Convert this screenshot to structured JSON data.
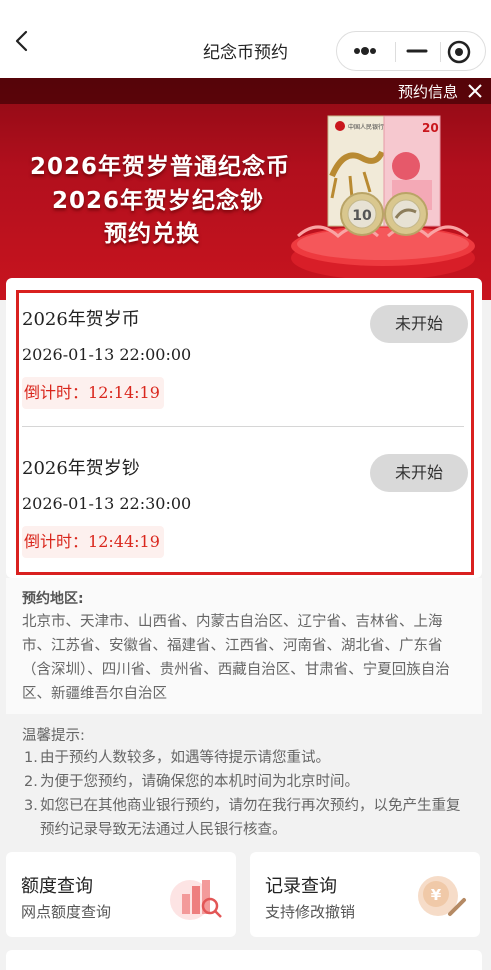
{
  "nav": {
    "title": "纪念币预约"
  },
  "banner": {
    "notice": "预约信息",
    "lines": [
      "2026年贺岁普通纪念币",
      "2026年贺岁纪念钞",
      "预约兑换"
    ],
    "art": {
      "note_value": "20",
      "note_label": "中国人民银行",
      "coin_value": "10"
    }
  },
  "reservations": [
    {
      "name": "2026年贺岁币",
      "time": "2026-01-13 22:00:00",
      "countdown_label": "倒计时：",
      "countdown": "12:14:19",
      "status": "未开始"
    },
    {
      "name": "2026年贺岁钞",
      "time": "2026-01-13 22:30:00",
      "countdown_label": "倒计时：",
      "countdown": "12:44:19",
      "status": "未开始"
    }
  ],
  "region": {
    "title": "预约地区:",
    "text": "北京市、天津市、山西省、内蒙古自治区、辽宁省、吉林省、上海市、江苏省、安徽省、福建省、江西省、河南省、湖北省、广东省（含深圳）、四川省、贵州省、西藏自治区、甘肃省、宁夏回族自治区、新疆维吾尔自治区"
  },
  "tips": {
    "title": "温馨提示:",
    "items": [
      {
        "num": "1.",
        "text": "由于预约人数较多，如遇等待提示请您重试。"
      },
      {
        "num": "2.",
        "text": "为便于您预约，请确保您的本机时间为北京时间。"
      },
      {
        "num": "3.",
        "text": "如您已在其他商业银行预约，请勿在我行再次预约，以免产生重复预约记录导致无法通过人民银行核查。"
      }
    ]
  },
  "cards": [
    {
      "title": "额度查询",
      "subtitle": "网点额度查询",
      "icon": "quota-search-icon"
    },
    {
      "title": "记录查询",
      "subtitle": "支持修改撤销",
      "icon": "record-edit-icon"
    }
  ],
  "colors": {
    "accent_red": "#d9201f",
    "banner_red": "#b10f1d",
    "countdown_red": "#d9261c"
  }
}
